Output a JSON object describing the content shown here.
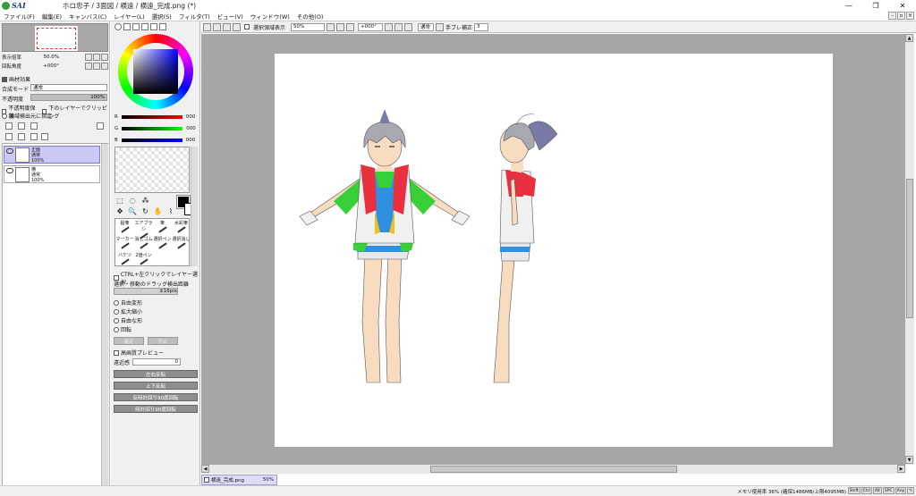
{
  "app": {
    "logo_text": "SAI",
    "window_title": "ホロ忠子 / 3面図 / 横遠 / 横遠_完成.png (*)"
  },
  "menu": [
    "ファイル(F)",
    "編集(E)",
    "キャンバス(C)",
    "レイヤー(L)",
    "選択(S)",
    "フィルタ(T)",
    "ビュー(V)",
    "ウィンドウ(W)",
    "その他(O)"
  ],
  "navigator": {
    "zoom_label": "表示倍率",
    "zoom_value": "50.0%",
    "rotation_label": "回転角度",
    "rotation_value": "+000°"
  },
  "layer_panel": {
    "section_title": "画材効果",
    "blend_label": "合成モード",
    "blend_value": "通常",
    "opacity_label": "不透明度",
    "opacity_value": "100%",
    "preserve_opacity": "不透明度保護",
    "clip_lower": "下のレイヤーでクリッピング",
    "selection_source": "領域検出元に指定",
    "layers": [
      {
        "name": "正面",
        "mode": "通常",
        "opacity": "100%",
        "selected": true
      },
      {
        "name": "横",
        "mode": "通常",
        "opacity": "100%",
        "selected": false
      }
    ]
  },
  "color": {
    "r_label": "R",
    "r_value": "000",
    "g_label": "G",
    "g_value": "000",
    "b_label": "B",
    "b_value": "000",
    "fg": "#000000",
    "bg": "#ffffff"
  },
  "brushes": [
    {
      "label": "鉛筆"
    },
    {
      "label": "エアブラシ"
    },
    {
      "label": "筆"
    },
    {
      "label": "水彩筆"
    },
    {
      "label": "マーカー"
    },
    {
      "label": "消しゴム"
    },
    {
      "label": "選択ペン"
    },
    {
      "label": "選択消し"
    },
    {
      "label": "バケツ"
    },
    {
      "label": "2値ペン"
    }
  ],
  "tool_options": {
    "ctrl_select": "CTRL+左クリックでレイヤー選択",
    "drag_label": "選択・移動のドラッグ検出距離",
    "drag_value": "±16pix",
    "transform_modes": [
      "自由変形",
      "拡大縮小",
      "自由な形",
      "回転"
    ],
    "ok_label": "確定",
    "cancel_label": "中止",
    "hq_preview": "高画質プレビュー",
    "perspective_label": "遠近感",
    "perspective_value": "0",
    "flip_h": "左右反転",
    "flip_v": "上下反転",
    "rotate_ccw": "反時計回り90度回転",
    "rotate_cw": "時計回り90度回転"
  },
  "toolbar": {
    "show_selection": "選択領域表示",
    "zoom": "50%",
    "rotation": "+000°",
    "blend": "通常",
    "stabilizer_label": "手ブレ補正",
    "stabilizer_value": "3"
  },
  "document_tab": {
    "name": "横遠_完成.png",
    "zoom": "50%"
  },
  "status": {
    "memory": "メモリ使用率 36% (確保1486MB/上限4095MB)",
    "keys": [
      "Shift",
      "Ctrl",
      "Alt",
      "SPC",
      "Any"
    ]
  }
}
